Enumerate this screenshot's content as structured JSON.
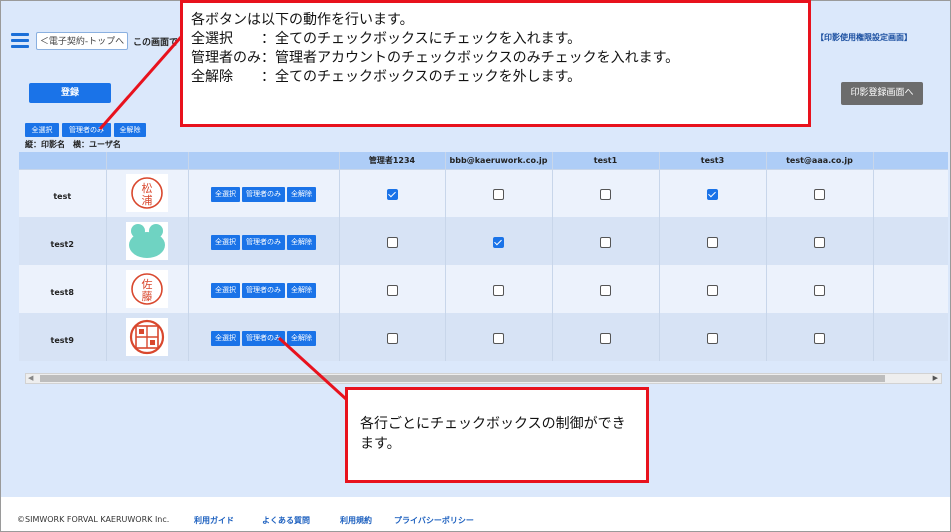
{
  "header": {
    "back_label": "＜電子契約-トップへ",
    "page_heading": "この画面で",
    "page_tag": "【印影使用権限設定画面】"
  },
  "actions": {
    "register_label": "登録",
    "stamp_register_label": "印影登録画面へ"
  },
  "bulk_controls": {
    "select_all": "全選択",
    "admin_only": "管理者のみ",
    "clear_all": "全解除"
  },
  "axis_label": "縦：印影名　横：ユーザ名",
  "columns": [
    "管理者1234",
    "bbb@kaeruwork.co.jp",
    "test1",
    "test3",
    "test@aaa.co.jp"
  ],
  "rows": [
    {
      "name": "test",
      "stamp": "seal-matsuura",
      "checks": [
        true,
        false,
        false,
        true,
        false
      ]
    },
    {
      "name": "test2",
      "stamp": "seal-frog",
      "checks": [
        false,
        true,
        false,
        false,
        false
      ]
    },
    {
      "name": "test8",
      "stamp": "seal-sato",
      "checks": [
        false,
        false,
        false,
        false,
        false
      ]
    },
    {
      "name": "test9",
      "stamp": "seal-square",
      "checks": [
        false,
        false,
        false,
        false,
        false
      ]
    }
  ],
  "row_controls": {
    "select_all": "全選択",
    "admin_only": "管理者のみ",
    "clear_all": "全解除"
  },
  "callout_top": {
    "lines": [
      "各ボタンは以下の動作を行います。",
      "全選択　　：全てのチェックボックスにチェックを入れます。",
      "管理者のみ：管理者アカウントのチェックボックスのみチェックを入れます。",
      "全解除　　：全てのチェックボックスのチェックを外します。"
    ]
  },
  "callout_bottom": {
    "lines": [
      "各行ごとにチェックボックスの制御ができます。"
    ]
  },
  "footer": {
    "copyright": "©SIMWORK FORVAL KAERUWORK Inc.",
    "links": [
      "利用ガイド",
      "よくある質問",
      "利用規約",
      "プライバシーポリシー"
    ]
  },
  "colors": {
    "primary": "#1a73e8",
    "highlight": "#e8121d",
    "stamp_red": "#d9482e",
    "frog": "#6fd3c2"
  }
}
